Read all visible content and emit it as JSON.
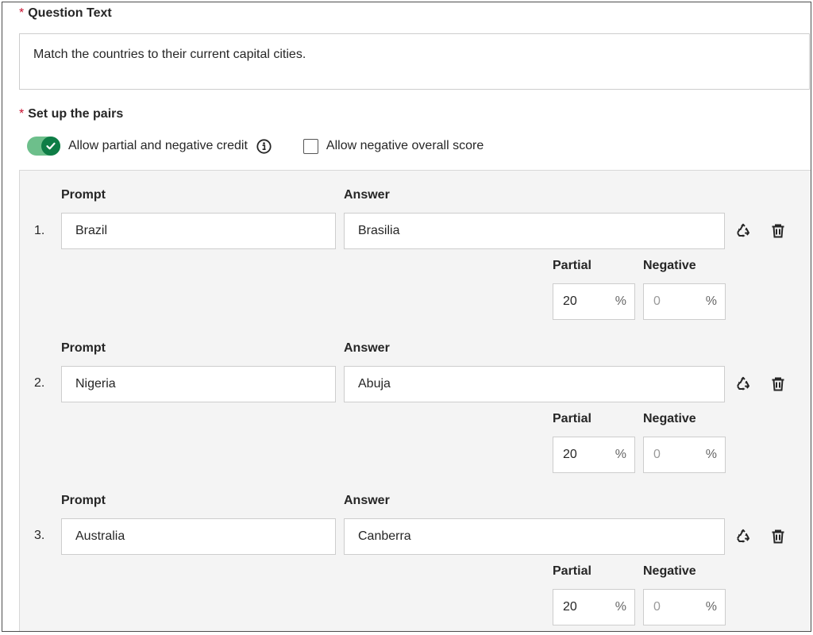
{
  "question_text": {
    "label": "Question Text",
    "value": "Match the countries to their current capital cities."
  },
  "pairs_section": {
    "label": "Set up the pairs",
    "partial_credit_toggle": {
      "label": "Allow partial and negative credit",
      "on": true
    },
    "negative_score_checkbox": {
      "label": "Allow negative overall score",
      "checked": false
    },
    "column_labels": {
      "prompt": "Prompt",
      "answer": "Answer",
      "partial": "Partial",
      "negative": "Negative"
    },
    "pairs": [
      {
        "number": "1.",
        "prompt": "Brazil",
        "answer": "Brasilia",
        "partial": "20",
        "negative": "0",
        "unit": "%"
      },
      {
        "number": "2.",
        "prompt": "Nigeria",
        "answer": "Abuja",
        "partial": "20",
        "negative": "0",
        "unit": "%"
      },
      {
        "number": "3.",
        "prompt": "Australia",
        "answer": "Canberra",
        "partial": "20",
        "negative": "0",
        "unit": "%"
      }
    ]
  },
  "required_marker": "*",
  "icons": {
    "info": "info-icon",
    "recycle": "recycle-icon",
    "delete": "trash-icon",
    "check": "checkmark-icon"
  },
  "colors": {
    "toggle_on": "#0e7d46",
    "required": "#c8102e"
  }
}
